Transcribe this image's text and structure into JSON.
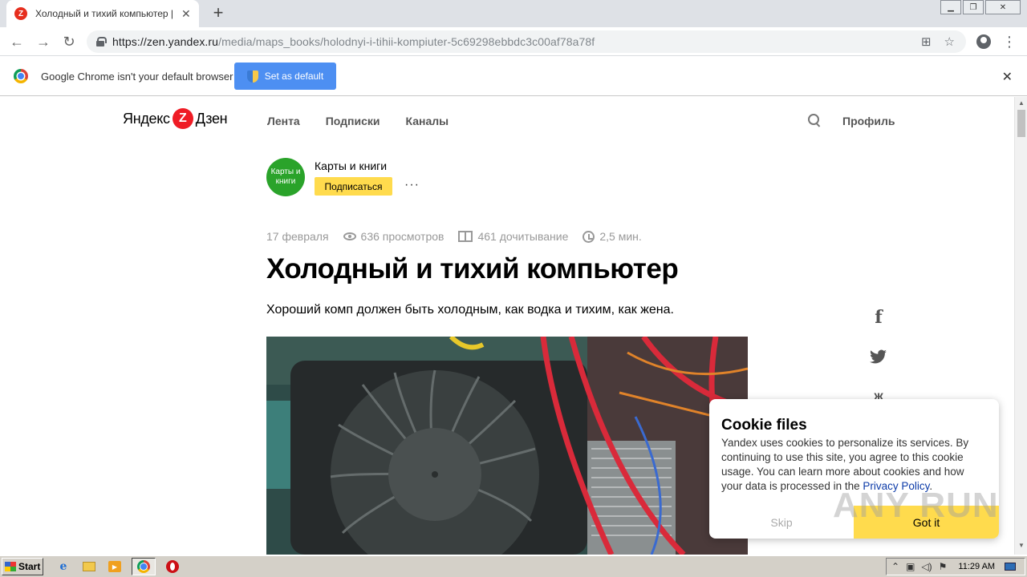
{
  "browser": {
    "tab_title": "Холодный и тихий компьютер | Ка",
    "tab_favicon": "Z",
    "url_host": "https://zen.yandex.ru",
    "url_path": "/media/maps_books/holodnyi-i-tihii-kompiuter-5c69298ebbdc3c00af78a78f",
    "infobar_text": "Google Chrome isn't your default browser",
    "set_default_label": "Set as default"
  },
  "site": {
    "logo_left": "Яндекс",
    "logo_mark": "Z",
    "logo_right": "Дзен",
    "nav": [
      "Лента",
      "Подписки",
      "Каналы"
    ],
    "profile_label": "Профиль"
  },
  "channel": {
    "avatar_text": "Карты и книги",
    "name": "Карты и книги",
    "subscribe_label": "Подписаться",
    "more": "···"
  },
  "article": {
    "date": "17 февраля",
    "views": "636 просмотров",
    "reads": "461 дочитывание",
    "read_time": "2,5 мин.",
    "title": "Холодный и тихий компьютер",
    "lead": "Хороший комп должен быть холодным, как водка и тихим, как жена."
  },
  "share": {
    "facebook": "f",
    "twitter": "t",
    "odnoklassniki": "ж"
  },
  "cookie": {
    "title": "Cookie files",
    "text": "Yandex uses cookies to personalize its services. By continuing to use this site, you agree to this cookie usage. You can learn more about cookies and how your data is processed in the",
    "link": "Privacy Policy",
    "link_suffix": ".",
    "skip_label": "Skip",
    "got_label": "Got it"
  },
  "watermark": "ANY RUN",
  "taskbar": {
    "start_label": "Start",
    "time": "11:29 AM"
  }
}
